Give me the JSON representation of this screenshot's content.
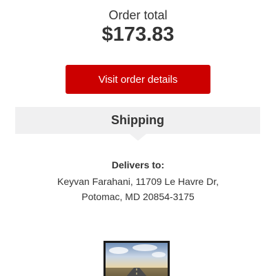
{
  "order": {
    "total_label": "Order total",
    "total_value": "$173.83",
    "visit_button_label": "Visit order details",
    "button_color": "#cc0000"
  },
  "shipping": {
    "section_title": "Shipping",
    "delivers_to_label": "Delivers to:",
    "address_line_1": "Keyvan Farahani, 11709 Le Havre Dr,",
    "address_line_2": "Potomac, MD 20854-3175"
  },
  "product": {
    "image_icon": "monitor-image"
  }
}
